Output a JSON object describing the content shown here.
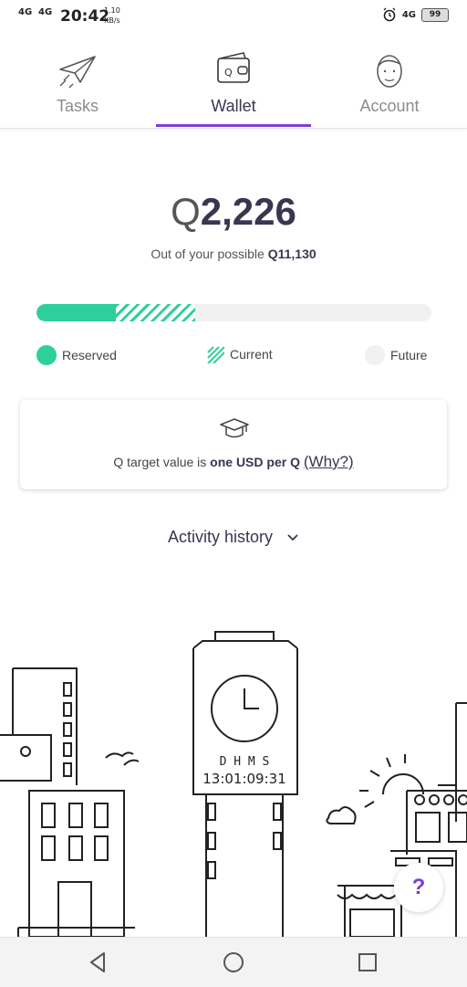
{
  "status_bar": {
    "network_1": "4G",
    "network_2": "4G",
    "time": "20:42",
    "speed_value": "1.10",
    "speed_unit": "KB/s",
    "signal_right": "4G",
    "battery": "99"
  },
  "tabs": [
    {
      "label": "Tasks",
      "icon": "paper-plane-icon",
      "active": false
    },
    {
      "label": "Wallet",
      "icon": "wallet-icon",
      "active": true
    },
    {
      "label": "Account",
      "icon": "face-icon",
      "active": false
    }
  ],
  "wallet": {
    "currency_symbol": "Q",
    "balance": "2,226",
    "possible_prefix": "Out of your possible ",
    "possible_amount": "11,130",
    "progress": {
      "reserved_fraction": 0.2,
      "current_fraction": 0.4
    }
  },
  "legend": {
    "reserved": "Reserved",
    "current": "Current",
    "future": "Future"
  },
  "info_card": {
    "icon": "graduation-cap-icon",
    "text_prefix": "Q target value is ",
    "text_bold": "one USD per Q",
    "why_link": "(Why?)"
  },
  "activity": {
    "label": "Activity history",
    "icon": "chevron-down-icon"
  },
  "clock_tower": {
    "labels": "D  H  M  S",
    "countdown": "13:01:09:31"
  },
  "help_button": "?",
  "colors": {
    "accent": "#7b3fd0",
    "reserved": "#2ecf9a",
    "text": "#3b3550"
  }
}
